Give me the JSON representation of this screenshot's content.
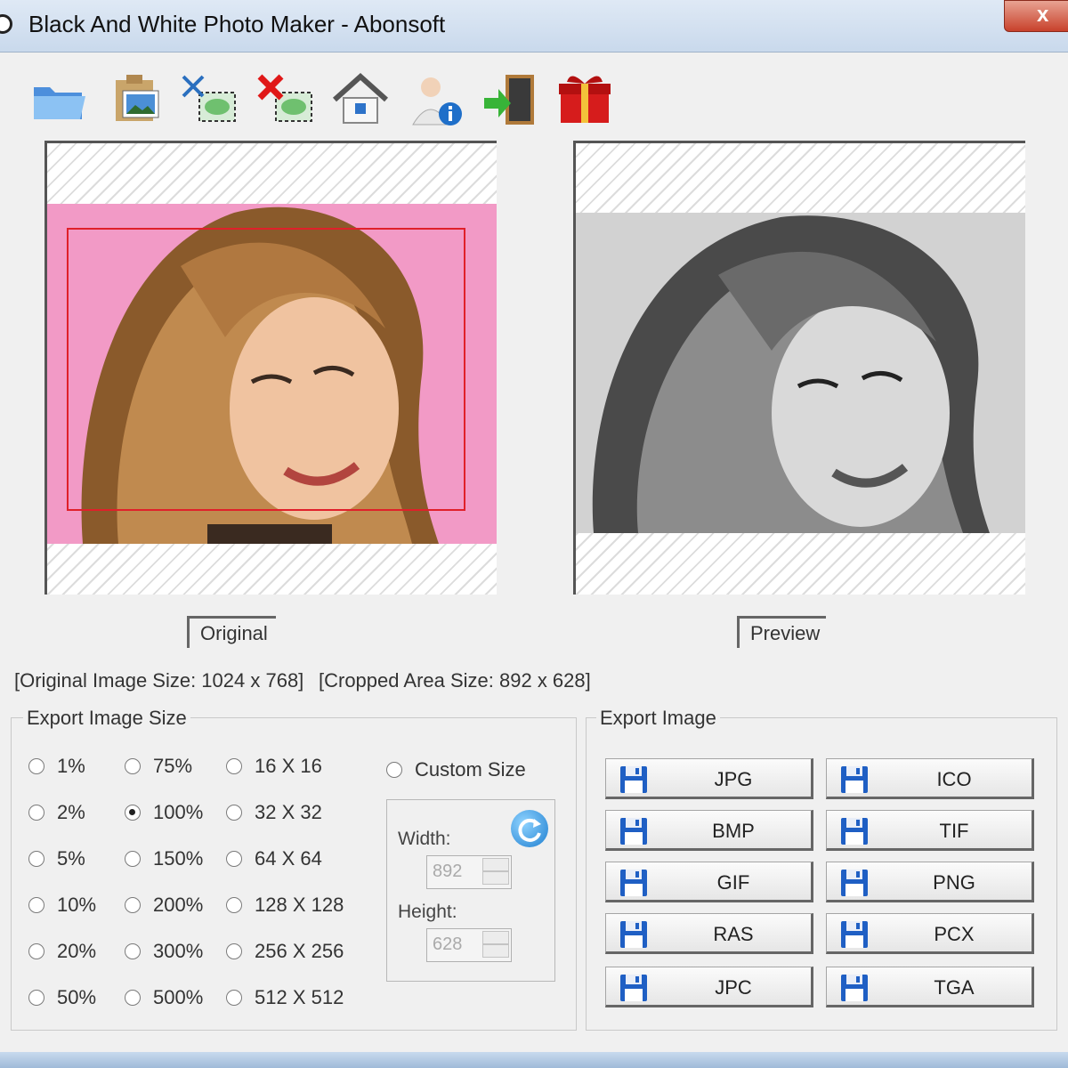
{
  "window": {
    "title": "Black And White Photo Maker - Abonsoft",
    "close_label": "x"
  },
  "toolbar": {
    "items": [
      "open-folder-icon",
      "load-image-icon",
      "cut-image-icon",
      "delete-image-icon",
      "home-icon",
      "user-info-icon",
      "exit-door-icon",
      "gift-icon"
    ]
  },
  "panels": {
    "original_label": "Original",
    "preview_label": "Preview"
  },
  "info": {
    "original_size": "[Original Image Size:  1024 x 768]",
    "cropped_size": "[Cropped Area Size:  892 x 628]"
  },
  "export_size": {
    "title": "Export Image Size",
    "col1": [
      "1%",
      "2%",
      "5%",
      "10%",
      "20%",
      "50%"
    ],
    "col2": [
      "75%",
      "100%",
      "150%",
      "200%",
      "300%",
      "500%"
    ],
    "col3": [
      "16 X 16",
      "32 X 32",
      "64 X 64",
      "128 X 128",
      "256 X 256",
      "512 X 512"
    ],
    "selected": "100%",
    "custom_label": "Custom Size",
    "width_label": "Width:",
    "width_value": "892",
    "height_label": "Height:",
    "height_value": "628"
  },
  "export_image": {
    "title": "Export Image",
    "left": [
      "JPG",
      "BMP",
      "GIF",
      "RAS",
      "JPC"
    ],
    "right": [
      "ICO",
      "TIF",
      "PNG",
      "PCX",
      "TGA"
    ]
  },
  "colors": {
    "photo_background": "#f29ac6",
    "crop_rectangle": "#e0202a"
  }
}
